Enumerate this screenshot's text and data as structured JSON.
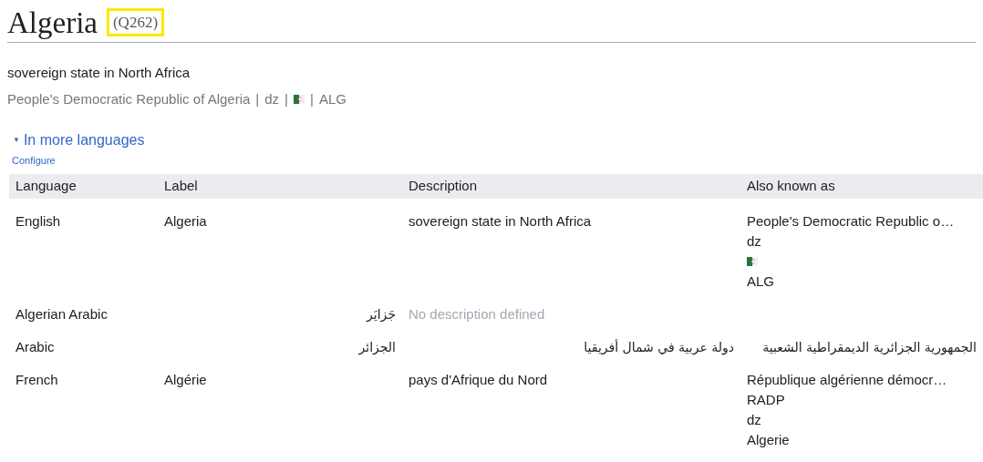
{
  "title": "Algeria",
  "id": {
    "text": "(Q262)",
    "highlighted": true
  },
  "description": "sovereign state in North Africa",
  "aliases": [
    {
      "kind": "text",
      "text": "People's Democratic Republic of Algeria"
    },
    {
      "kind": "sep",
      "text": "|"
    },
    {
      "kind": "text",
      "text": "dz"
    },
    {
      "kind": "sep",
      "text": "|"
    },
    {
      "kind": "flag"
    },
    {
      "kind": "sep",
      "text": "|"
    },
    {
      "kind": "text",
      "text": "ALG"
    }
  ],
  "toggle": {
    "icon": "▼",
    "label": "In more languages",
    "expanded": true
  },
  "configure": "Configure",
  "table": {
    "columns": [
      "Language",
      "Label",
      "Description",
      "Also known as"
    ],
    "rows": [
      {
        "language": "English",
        "label": {
          "text": "Algeria",
          "rtl": false
        },
        "description": {
          "text": "sovereign state in North Africa",
          "rtl": false,
          "missing": false
        },
        "aliases": [
          {
            "kind": "text",
            "text": "People's Democratic Republic o…",
            "rtl": false
          },
          {
            "kind": "text",
            "text": "dz",
            "rtl": false
          },
          {
            "kind": "flag"
          },
          {
            "kind": "text",
            "text": "ALG",
            "rtl": false
          }
        ]
      },
      {
        "language": "Algerian Arabic",
        "label": {
          "text": "جَزايَر",
          "rtl": true
        },
        "description": {
          "text": "No description defined",
          "rtl": false,
          "missing": true
        },
        "aliases": []
      },
      {
        "language": "Arabic",
        "label": {
          "text": "الجزائر",
          "rtl": true
        },
        "description": {
          "text": "دولة عربية في شمال أفريقيا",
          "rtl": true,
          "missing": false
        },
        "aliases": [
          {
            "kind": "text",
            "text": "الجمهورية الجزائرية الديمقراطية الشعبية",
            "rtl": true
          }
        ]
      },
      {
        "language": "French",
        "label": {
          "text": "Algérie",
          "rtl": false
        },
        "description": {
          "text": "pays d'Afrique du Nord",
          "rtl": false,
          "missing": false
        },
        "aliases": [
          {
            "kind": "text",
            "text": "République algérienne démocr…",
            "rtl": false
          },
          {
            "kind": "text",
            "text": "RADP",
            "rtl": false
          },
          {
            "kind": "text",
            "text": "dz",
            "rtl": false
          },
          {
            "kind": "text",
            "text": "Algerie",
            "rtl": false
          }
        ]
      }
    ]
  }
}
